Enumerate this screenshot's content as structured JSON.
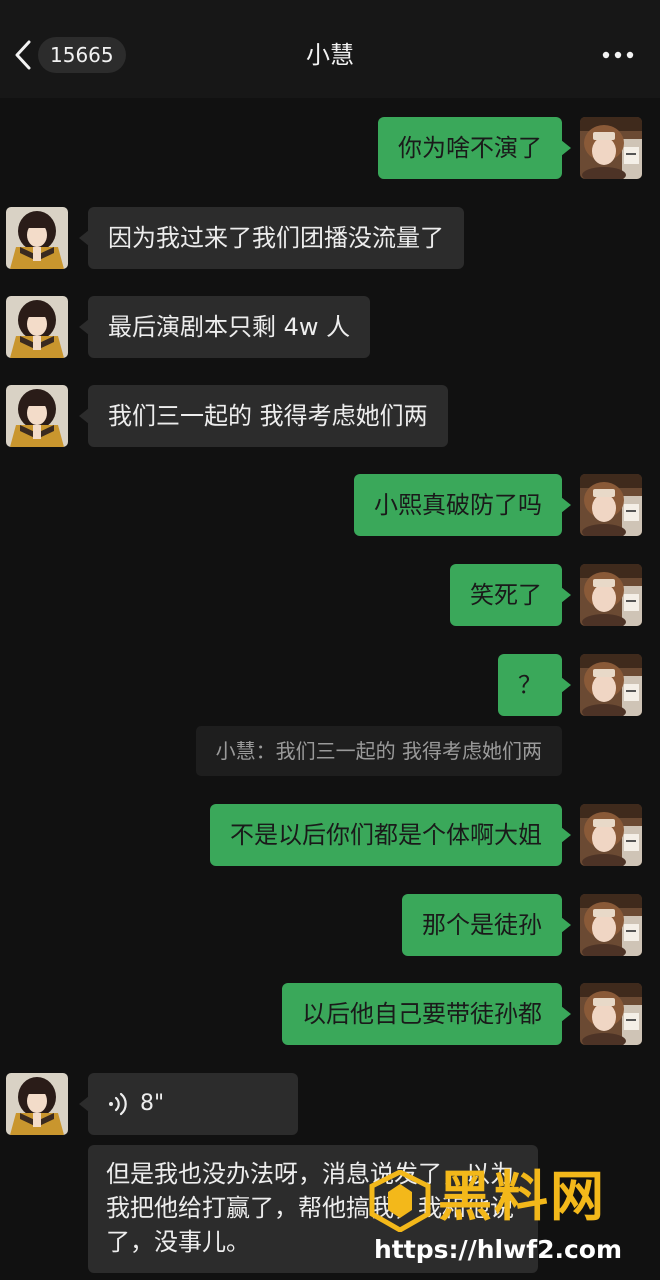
{
  "header": {
    "unread_count": "15665",
    "title": "小慧"
  },
  "messages": [
    {
      "side": "me",
      "text": "你为啥不演了"
    },
    {
      "side": "other",
      "text": "因为我过来了我们团播没流量了"
    },
    {
      "side": "other",
      "text": "最后演剧本只剩 4w 人"
    },
    {
      "side": "other",
      "text": "我们三一起的 我得考虑她们两"
    },
    {
      "side": "me",
      "text": "小熙真破防了吗"
    },
    {
      "side": "me",
      "text": "笑死了"
    },
    {
      "side": "me",
      "text": "？"
    },
    {
      "side": "me",
      "text": "不是以后你们都是个体啊大姐"
    },
    {
      "side": "me",
      "text": "那个是徒孙"
    },
    {
      "side": "me",
      "text": "以后他自己要带徒孙都"
    }
  ],
  "quote": {
    "text": "小慧：我们三一起的 我得考虑她们两"
  },
  "voice_message": {
    "duration": "8\"",
    "transcript": "但是我也没办法呀，消息说发了，以为我把他给打赢了，帮他搞我，我和他说了，没事儿。"
  },
  "watermark": {
    "brand": "黑料网",
    "url": "https://hlwf2.com"
  },
  "colors": {
    "background": "#111111",
    "my_bubble": "#3aa85a",
    "other_bubble": "#2c2c2c",
    "watermark_brand": "#f3b81a"
  }
}
